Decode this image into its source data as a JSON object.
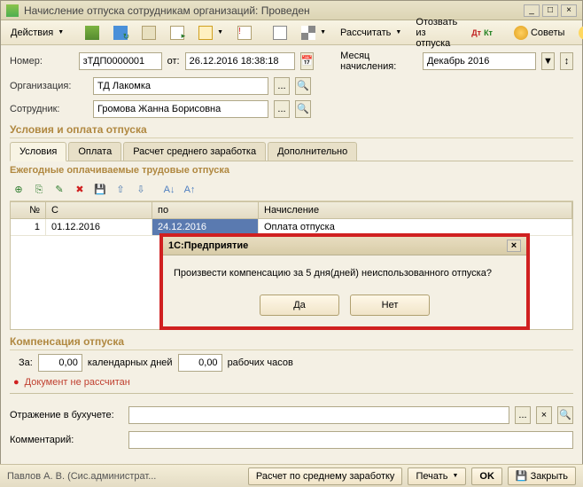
{
  "window": {
    "title": "Начисление отпуска сотрудникам организаций: Проведен"
  },
  "toolbar": {
    "actions": "Действия",
    "calc": "Рассчитать",
    "recall": "Отозвать из отпуска",
    "tips": "Советы"
  },
  "form": {
    "number_label": "Номер:",
    "number_value": "зТДП0000001",
    "from_label": "от:",
    "date_value": "26.12.2016 18:38:18",
    "month_label": "Месяц начисления:",
    "month_value": "Декабрь 2016",
    "org_label": "Организация:",
    "org_value": "ТД Лакомка",
    "emp_label": "Сотрудник:",
    "emp_value": "Громова Жанна Борисовна"
  },
  "sections": {
    "conditions": "Условия и оплата отпуска",
    "compensation": "Компенсация отпуска"
  },
  "tabs": {
    "conditions": "Условия",
    "payment": "Оплата",
    "avg": "Расчет среднего заработка",
    "extra": "Дополнительно"
  },
  "subheader": "Ежегодные оплачиваемые трудовые отпуска",
  "grid": {
    "headers": {
      "num": "№",
      "from": "С",
      "to": "по",
      "calc": "Начисление"
    },
    "rows": [
      {
        "num": "1",
        "from": "01.12.2016",
        "to": "24.12.2016",
        "calc": "Оплата отпуска"
      }
    ]
  },
  "dialog": {
    "title": "1С:Предприятие",
    "message": "Произвести компенсацию за 5 дня(дней) неиспользованного отпуска?",
    "yes": "Да",
    "no": "Нет"
  },
  "comp": {
    "za": "За:",
    "days_value": "0,00",
    "days_label": "календарных дней",
    "hours_value": "0,00",
    "hours_label": "рабочих часов"
  },
  "error": "Документ не рассчитан",
  "bottom": {
    "acc_label": "Отражение в бухучете:",
    "comment_label": "Комментарий:"
  },
  "status": {
    "user": "Павлов А. В. (Сис.администрат...",
    "avg": "Расчет по среднему заработку",
    "print": "Печать",
    "ok": "OK",
    "close": "Закрыть"
  }
}
